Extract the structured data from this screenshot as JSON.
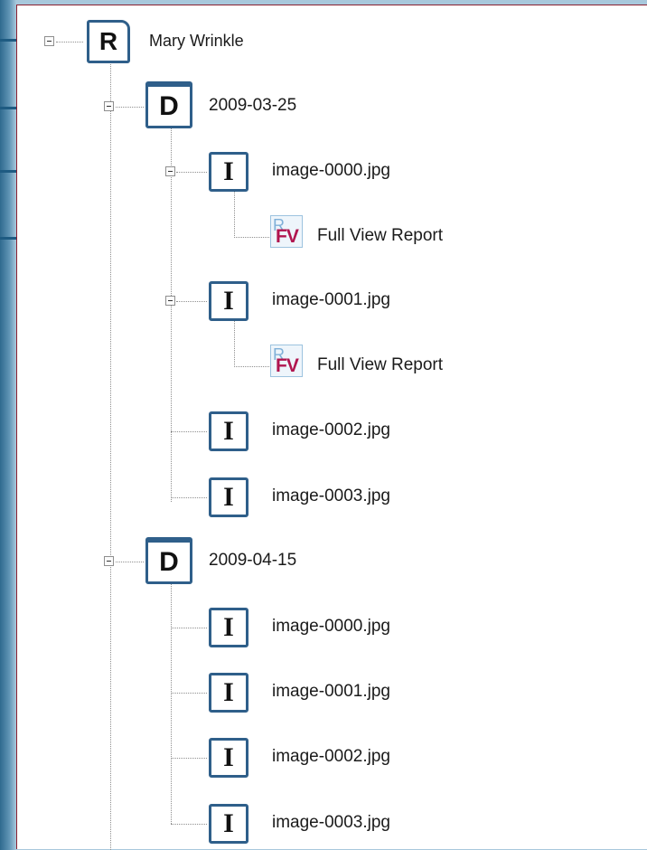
{
  "tree": {
    "root_label": "Mary Wrinkle",
    "root_icon_letter": "R",
    "studies": [
      {
        "label": "2009-03-25",
        "icon_letter": "D",
        "images": [
          {
            "label": "image-0000.jpg",
            "icon_letter": "I",
            "report_label": "Full View Report"
          },
          {
            "label": "image-0001.jpg",
            "icon_letter": "I",
            "report_label": "Full View Report"
          },
          {
            "label": "image-0002.jpg",
            "icon_letter": "I"
          },
          {
            "label": "image-0003.jpg",
            "icon_letter": "I"
          }
        ]
      },
      {
        "label": "2009-04-15",
        "icon_letter": "D",
        "images": [
          {
            "label": "image-0000.jpg",
            "icon_letter": "I"
          },
          {
            "label": "image-0001.jpg",
            "icon_letter": "I"
          },
          {
            "label": "image-0002.jpg",
            "icon_letter": "I"
          },
          {
            "label": "image-0003.jpg",
            "icon_letter": "I"
          }
        ]
      }
    ],
    "report_icon": {
      "back_glyph": "R",
      "front_text": "FV"
    }
  },
  "colors": {
    "accent": "#1e5b82",
    "icon_border": "#2f5f8a",
    "report_text": "#b0154f",
    "panel_border": "#8a2030"
  }
}
